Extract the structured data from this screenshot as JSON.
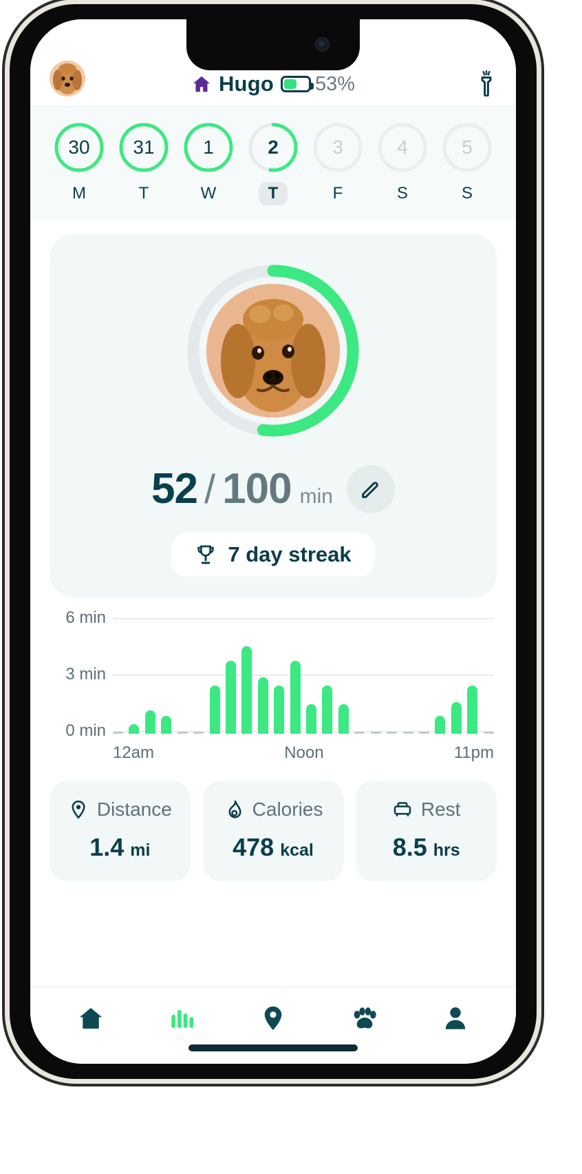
{
  "header": {
    "avatar_name": "dog-avatar",
    "home_icon": "house-icon",
    "title": "Hugo",
    "battery_percent": "53%",
    "battery_level": 53,
    "flashlight_icon": "flashlight-icon"
  },
  "daystrip": {
    "days": [
      {
        "num": "30",
        "label": "M",
        "state": "complete",
        "progress": 100
      },
      {
        "num": "31",
        "label": "T",
        "state": "complete",
        "progress": 100
      },
      {
        "num": "1",
        "label": "W",
        "state": "complete",
        "progress": 100
      },
      {
        "num": "2",
        "label": "T",
        "state": "today",
        "progress": 52
      },
      {
        "num": "3",
        "label": "F",
        "state": "future",
        "progress": 0
      },
      {
        "num": "4",
        "label": "S",
        "state": "future",
        "progress": 0
      },
      {
        "num": "5",
        "label": "S",
        "state": "future",
        "progress": 0
      }
    ]
  },
  "hero": {
    "progress_percent": 52,
    "current": "52",
    "separator": "/",
    "goal": "100",
    "unit": "min",
    "edit_icon": "pencil-icon",
    "streak_icon": "trophy-icon",
    "streak_text": "7 day streak",
    "photo_name": "dog-photo"
  },
  "chart_data": {
    "type": "bar",
    "title": "",
    "xlabel": "",
    "ylabel": "min",
    "ylim": [
      0,
      7
    ],
    "grid": true,
    "legend": "none",
    "ytick_labels": [
      "6 min",
      "3 min",
      "0 min"
    ],
    "ytick_values": [
      6,
      3,
      0
    ],
    "xtick_labels": [
      "12am",
      "Noon",
      "11pm"
    ],
    "categories": [
      "12am",
      "1am",
      "2am",
      "3am",
      "4am",
      "5am",
      "6am",
      "7am",
      "8am",
      "9am",
      "10am",
      "11am",
      "Noon",
      "1pm",
      "2pm",
      "3pm",
      "4pm",
      "5pm",
      "6pm",
      "7pm",
      "8pm",
      "9pm",
      "10pm",
      "11pm"
    ],
    "values": [
      0,
      0.6,
      1.4,
      1.1,
      0,
      0,
      2.9,
      4.4,
      5.3,
      3.4,
      2.9,
      4.4,
      1.8,
      2.9,
      1.8,
      0,
      0,
      0,
      0,
      0,
      1.1,
      1.9,
      2.9,
      0
    ]
  },
  "metrics": [
    {
      "icon": "pin-icon",
      "label": "Distance",
      "value": "1.4",
      "unit": "mi"
    },
    {
      "icon": "flame-icon",
      "label": "Calories",
      "value": "478",
      "unit": "kcal"
    },
    {
      "icon": "sofa-icon",
      "label": "Rest",
      "value": "8.5",
      "unit": "hrs"
    }
  ],
  "tabbar": {
    "items": [
      {
        "icon": "home-icon",
        "active": false
      },
      {
        "icon": "bar-chart-icon",
        "active": true
      },
      {
        "icon": "location-icon",
        "active": false
      },
      {
        "icon": "paw-icon",
        "active": false
      },
      {
        "icon": "person-icon",
        "active": false
      }
    ]
  },
  "colors": {
    "green": "#3ce882",
    "dark_teal": "#08404c",
    "muted": "#64797f",
    "card_bg": "#f2f7f8",
    "purple": "#5b2a96"
  }
}
